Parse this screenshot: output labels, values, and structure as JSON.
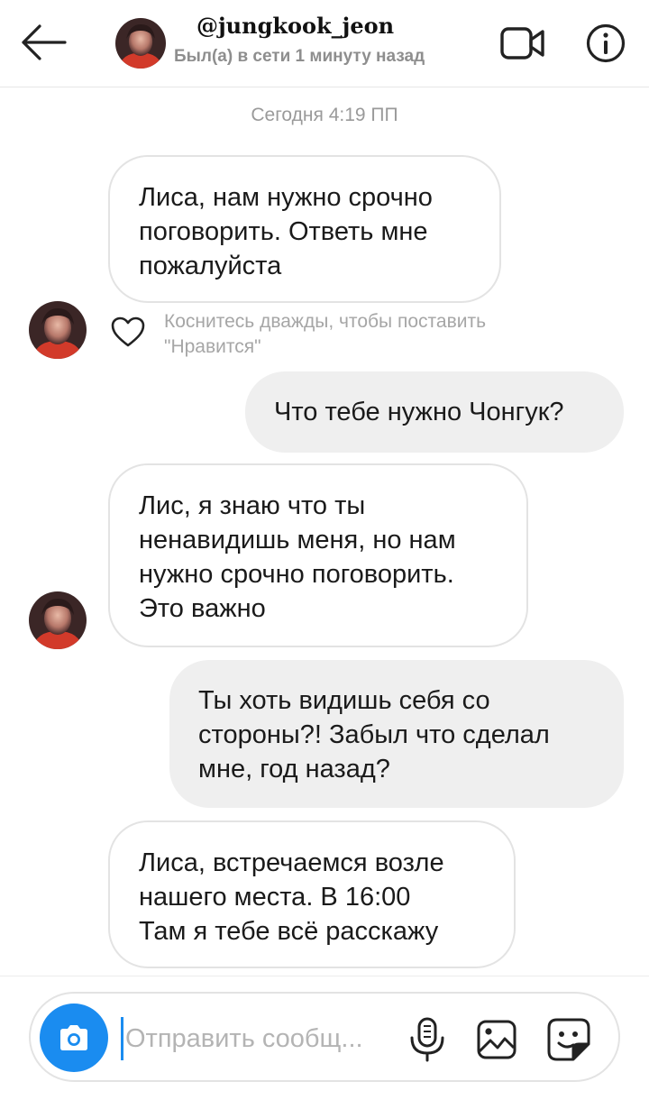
{
  "header": {
    "username": "@jungkook_jeon",
    "status": "Был(а) в сети 1 минуту назад"
  },
  "thread": {
    "timestamp": "Сегодня 4:19 ПП",
    "like_hint_line1": "Коснитесь дважды, чтобы поставить",
    "like_hint_line2": "\"Нравится\"",
    "messages": [
      {
        "direction": "incoming",
        "lines": [
          "Лиса, нам нужно срочно",
          "поговорить. Ответь мне",
          "пожалуйста"
        ]
      },
      {
        "direction": "outgoing",
        "lines": [
          "Что тебе нужно Чонгук?"
        ]
      },
      {
        "direction": "incoming",
        "lines": [
          "Лис, я знаю что ты",
          "ненавидишь меня, но нам",
          "нужно срочно поговорить.",
          "Это важно"
        ]
      },
      {
        "direction": "outgoing",
        "lines": [
          "Ты хоть видишь себя со",
          "стороны?! Забыл что сделал",
          "мне, год назад?"
        ]
      },
      {
        "direction": "incoming",
        "lines": [
          "Лиса, встречаемся возле",
          "нашего места. В 16:00",
          "Там я тебе всё расскажу"
        ]
      }
    ]
  },
  "composer": {
    "placeholder": "Отправить сообщ...",
    "value": ""
  },
  "icons": {
    "back": "arrow-left-icon",
    "video": "video-camera-icon",
    "info": "info-icon",
    "heart": "heart-icon",
    "camera": "camera-icon",
    "mic": "microphone-icon",
    "gallery": "image-icon",
    "sticker": "sticker-icon"
  },
  "colors": {
    "accent": "#1a8cf0",
    "incoming_bubble": "#ffffff",
    "outgoing_bubble": "#efefef",
    "secondary_text": "#8e8e8e"
  }
}
